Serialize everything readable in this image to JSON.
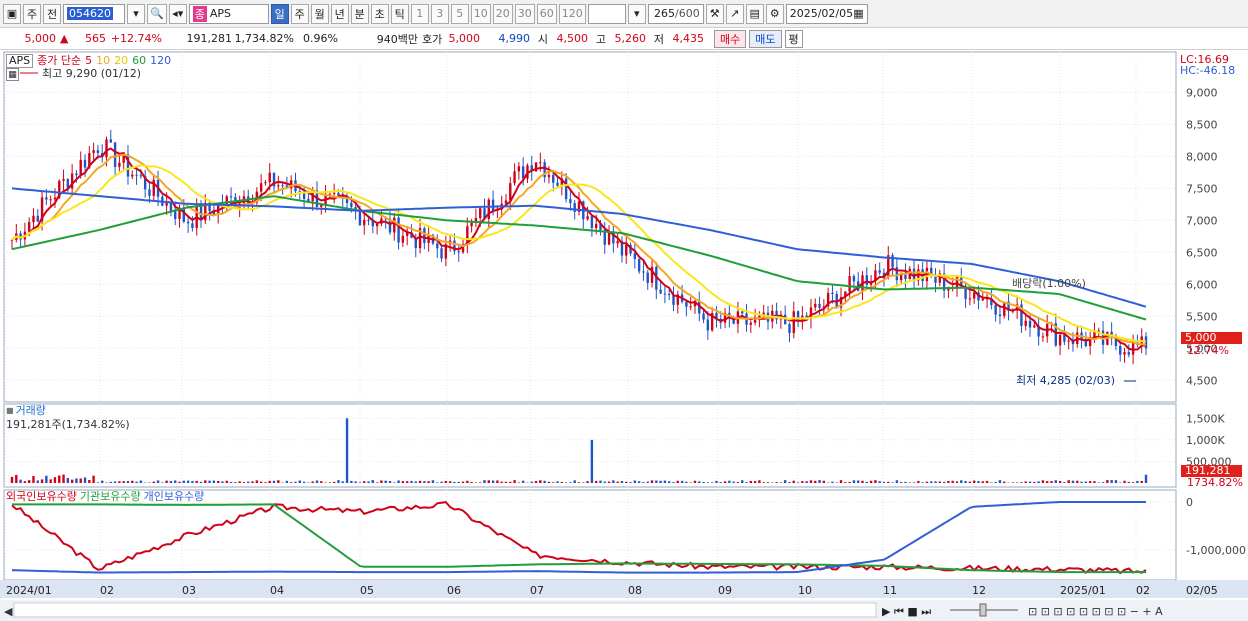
{
  "toolbar": {
    "period_label": "주",
    "prev_label": "전",
    "code": "054620",
    "name": "APS",
    "type_badge": "종",
    "intervals": [
      "일",
      "주",
      "월",
      "년",
      "분",
      "초",
      "틱"
    ],
    "selected_interval": "일",
    "minutes": [
      "1",
      "3",
      "5",
      "10",
      "20",
      "30",
      "60",
      "120"
    ],
    "count": "265",
    "count_max": "/600",
    "date": "2025/02/05"
  },
  "quote": {
    "price": "5,000",
    "up_arrow": "▲",
    "change": "565",
    "change_pct": "+12.74%",
    "volume": "191,281",
    "volume_pct": "1,734.82%",
    "turnover": "0.96%",
    "amount": "940백만",
    "bid_label": "호가",
    "ask": "5,000",
    "bid": "4,990",
    "open_label": "시",
    "open": "4,500",
    "high_label": "고",
    "high": "5,260",
    "low_label": "저",
    "low": "4,435",
    "buy_label": "매수",
    "sell_label": "매도",
    "avg_label": "평"
  },
  "price_panel": {
    "ticker": "APS",
    "legend_prefix": "종가 단순",
    "ma_periods": [
      "5",
      "10",
      "20",
      "60",
      "120"
    ],
    "ma_colors": [
      "#d0021b",
      "#f5a623",
      "#f8e71c",
      "#1f9e3a",
      "#2f5fd6"
    ],
    "high_note": "최고 9,290 (01/12)",
    "low_note": "최저 4,285 (02/03)",
    "ex_dividend_note": "배당락(1.00%)",
    "lc": "LC:16.69",
    "hc": "HC:-46.18",
    "price_tag": "5,000",
    "pct_tag": "12.74%",
    "y_ticks": [
      "9,000",
      "8,500",
      "8,000",
      "7,500",
      "7,000",
      "6,500",
      "6,000",
      "5,500",
      "5,000",
      "4,500"
    ]
  },
  "volume_panel": {
    "title": "거래량",
    "value": "191,281주(1,734.82%)",
    "y_ticks": [
      "1,500K",
      "1,000K",
      "500,000"
    ],
    "tag_value": "191,281",
    "tag_pct": "1734.82%"
  },
  "holder_panel": {
    "series_labels": [
      "외국인보유수량",
      "기관보유수량",
      "개인보유수량"
    ],
    "series_colors": [
      "#d0021b",
      "#1f9e3a",
      "#2f5fd6"
    ],
    "y_ticks": [
      "0",
      "-1,000,000"
    ]
  },
  "x_axis": {
    "labels": [
      "2024/01",
      "02",
      "03",
      "04",
      "05",
      "06",
      "07",
      "08",
      "09",
      "10",
      "11",
      "12",
      "2025/01",
      "02"
    ],
    "end_label": "02/05"
  },
  "chart_data": {
    "type": "line",
    "title": "APS",
    "x": [
      "2024/01",
      "02",
      "03",
      "04",
      "05",
      "06",
      "07",
      "08",
      "09",
      "10",
      "11",
      "12",
      "2025/01",
      "02"
    ],
    "series": [
      {
        "name": "종가",
        "values": [
          6700,
          8200,
          7000,
          7600,
          7100,
          6500,
          8000,
          6500,
          5400,
          5400,
          6300,
          5900,
          5200,
          5000
        ]
      },
      {
        "name": "120",
        "values": [
          7500,
          7380,
          7260,
          7220,
          7150,
          7200,
          7230,
          7100,
          6850,
          6550,
          6420,
          6320,
          6050,
          5650
        ]
      },
      {
        "name": "60",
        "values": [
          6550,
          6850,
          7200,
          7380,
          7150,
          7000,
          6920,
          6800,
          6450,
          6050,
          5920,
          5950,
          5850,
          5450
        ]
      }
    ],
    "ylim": [
      4285,
      9290
    ]
  }
}
